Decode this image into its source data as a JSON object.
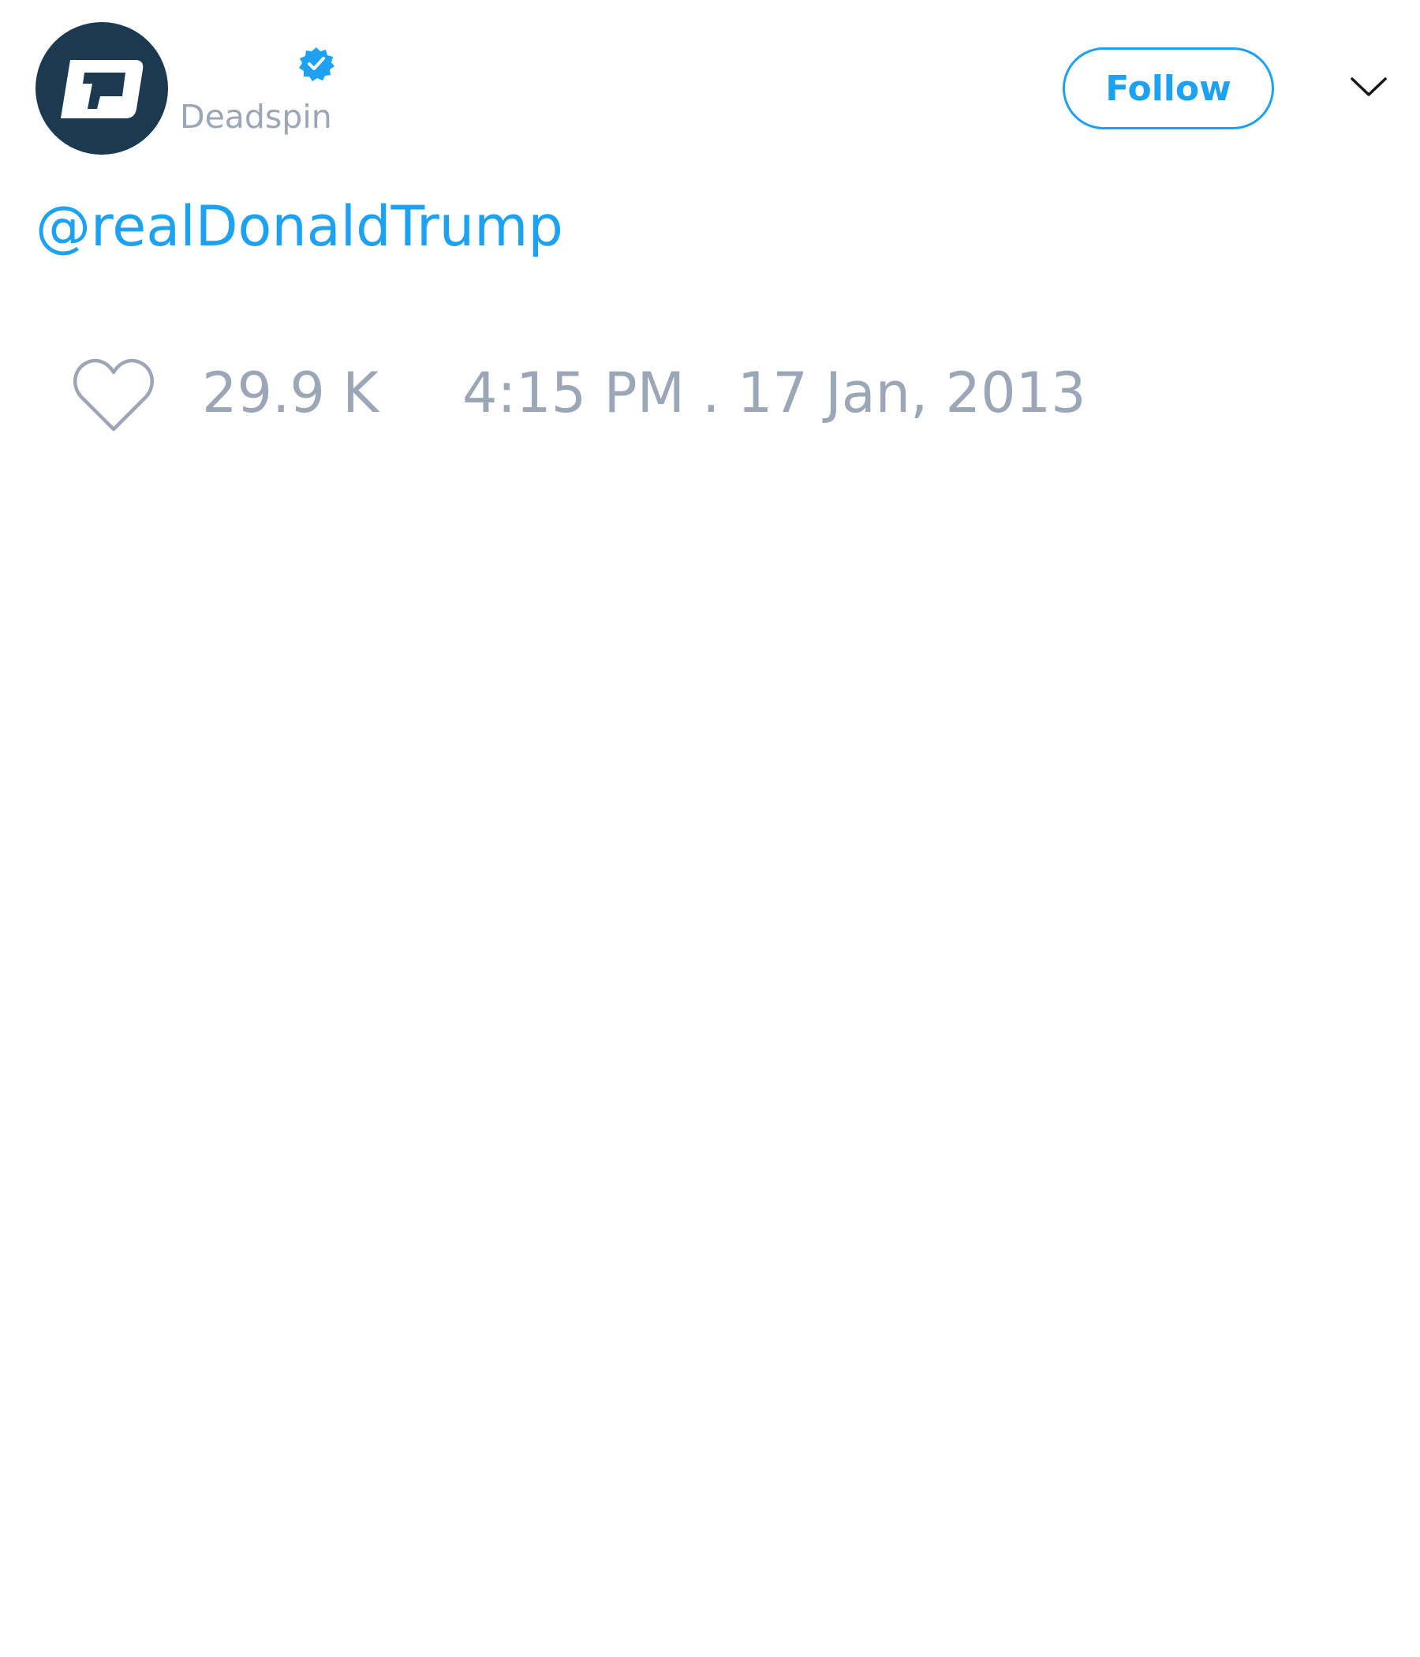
{
  "author": {
    "display_name": "",
    "handle": "Deadspin",
    "verified": true,
    "avatar": {
      "icon": "deadspin-logo-icon",
      "background": "#1b3a52"
    }
  },
  "header": {
    "follow_label": "Follow",
    "menu_icon": "chevron-down-icon"
  },
  "tweet": {
    "text": "@realDonaldTrump",
    "mention_color": "#1da1f2"
  },
  "footer": {
    "like_icon": "heart-icon",
    "like_count": "29.9 K",
    "timestamp": "4:15 PM . 17 Jan, 2013"
  },
  "colors": {
    "accent": "#1da1f2",
    "muted_text": "#9ba6b6"
  }
}
